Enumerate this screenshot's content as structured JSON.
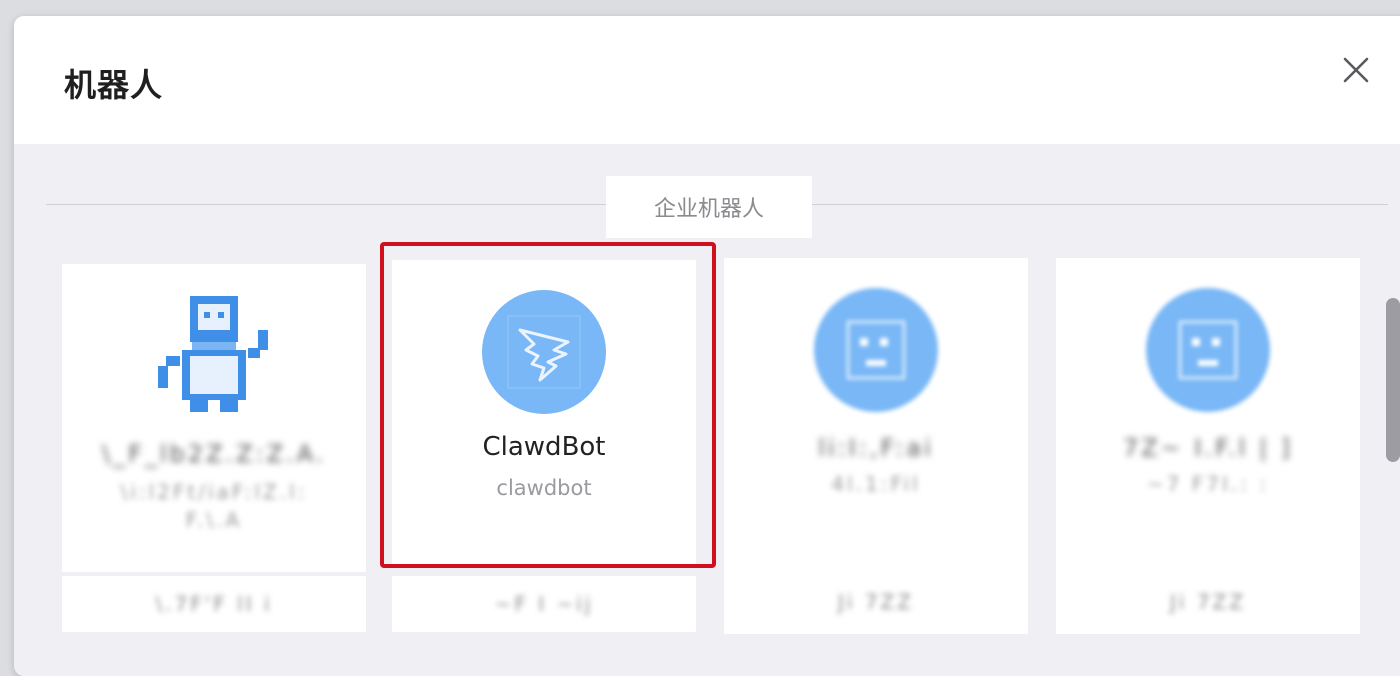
{
  "dialog": {
    "title": "机器人",
    "close_icon": "close-icon",
    "section_label": "企业机器人"
  },
  "robots": [
    {
      "name": "\\_F_lb2Z.Z:Z.A.",
      "id": "\\i:l2Ft/iaF:lZ.l: F.\\.A",
      "footer": "\\.7F'F lI i",
      "avatar_icon": "pixel-robot-icon"
    },
    {
      "name": "ClawdBot",
      "id": "clawdbot",
      "footer": "~F I ~ij",
      "avatar_icon": "dingtalk-wing-icon",
      "highlighted": true
    },
    {
      "name": "li:I:,F:ai",
      "id": "4l.1:Fil",
      "footer": "Ji 7ZZ",
      "avatar_icon": "default-bot-icon"
    },
    {
      "name": "7Z~ I.F.l | ]",
      "id": "~7 F7I.: :",
      "footer": "Ji 7ZZ",
      "avatar_icon": "default-bot-icon"
    }
  ],
  "colors": {
    "highlight": "#d0101e",
    "avatar_blue": "#79b7f6",
    "panel_bg": "#f0f0f4"
  }
}
